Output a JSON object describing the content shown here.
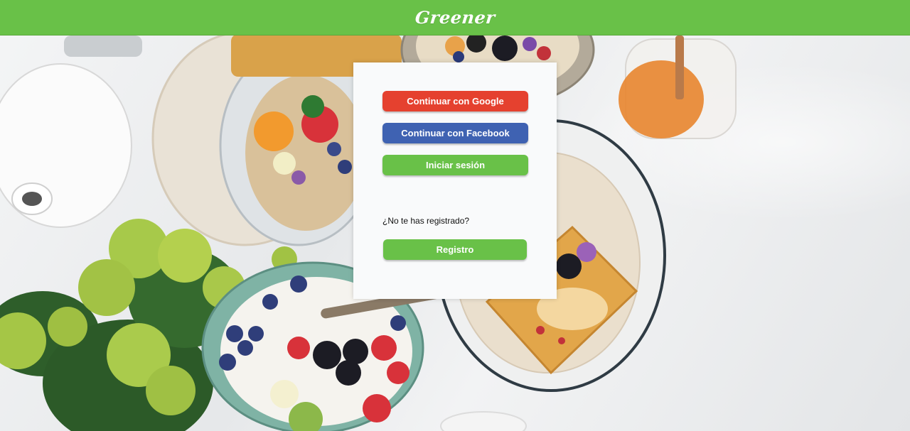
{
  "header": {
    "logo_text": "Greener",
    "background_color": "#69c148"
  },
  "login_card": {
    "google_button_label": "Continuar con Google",
    "facebook_button_label": "Continuar con Facebook",
    "login_button_label": "Iniciar sesión",
    "register_prompt": "¿No te has registrado?",
    "register_button_label": "Registro",
    "google_color": "#e5412f",
    "facebook_color": "#3f62b2",
    "green_color": "#69c148"
  }
}
